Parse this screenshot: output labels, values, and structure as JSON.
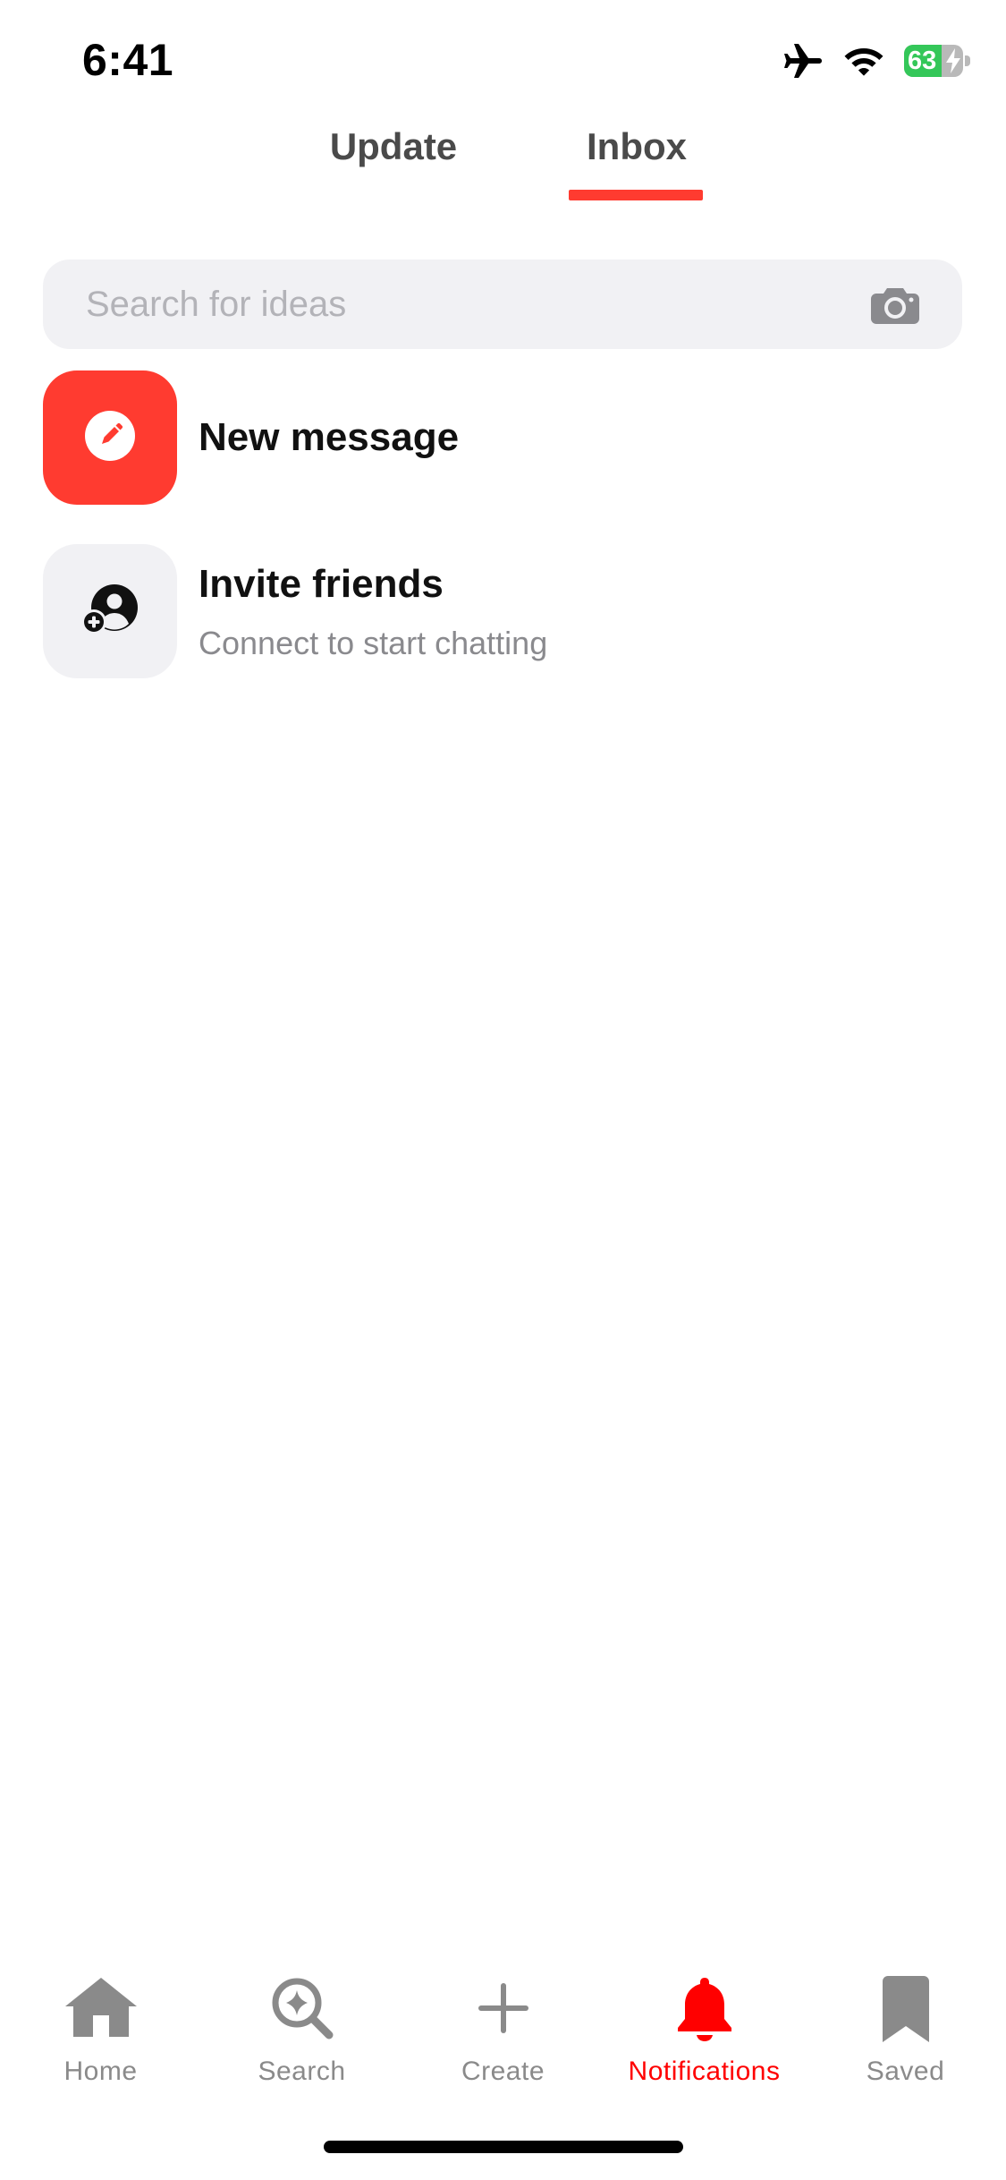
{
  "status_bar": {
    "time": "6:41",
    "battery_level": "63",
    "battery_fraction": 0.63,
    "icons": [
      "airplane-icon",
      "wifi-icon",
      "battery-charging-icon"
    ]
  },
  "tabs": [
    {
      "label": "Update",
      "active": false
    },
    {
      "label": "Inbox",
      "active": true
    }
  ],
  "search": {
    "placeholder": "Search for ideas",
    "value": "",
    "icon": "camera-icon"
  },
  "list": [
    {
      "title": "New message",
      "subtitle": "",
      "icon": "pencil-icon"
    },
    {
      "title": "Invite friends",
      "subtitle": "Connect to start chatting",
      "icon": "add-user-icon"
    }
  ],
  "bottom_nav": [
    {
      "label": "Home",
      "icon": "home-icon",
      "active": false
    },
    {
      "label": "Search",
      "icon": "search-sparkle-icon",
      "active": false
    },
    {
      "label": "Create",
      "icon": "plus-icon",
      "active": false
    },
    {
      "label": "Notifications",
      "icon": "bell-icon",
      "active": true
    },
    {
      "label": "Saved",
      "icon": "bookmark-icon",
      "active": false
    }
  ],
  "colors": {
    "accent": "#ff3b30",
    "active_nav": "#ff0000",
    "inactive_nav": "#8a8a8a",
    "battery_green": "#34c759",
    "tile_grey": "#f1f1f4"
  }
}
